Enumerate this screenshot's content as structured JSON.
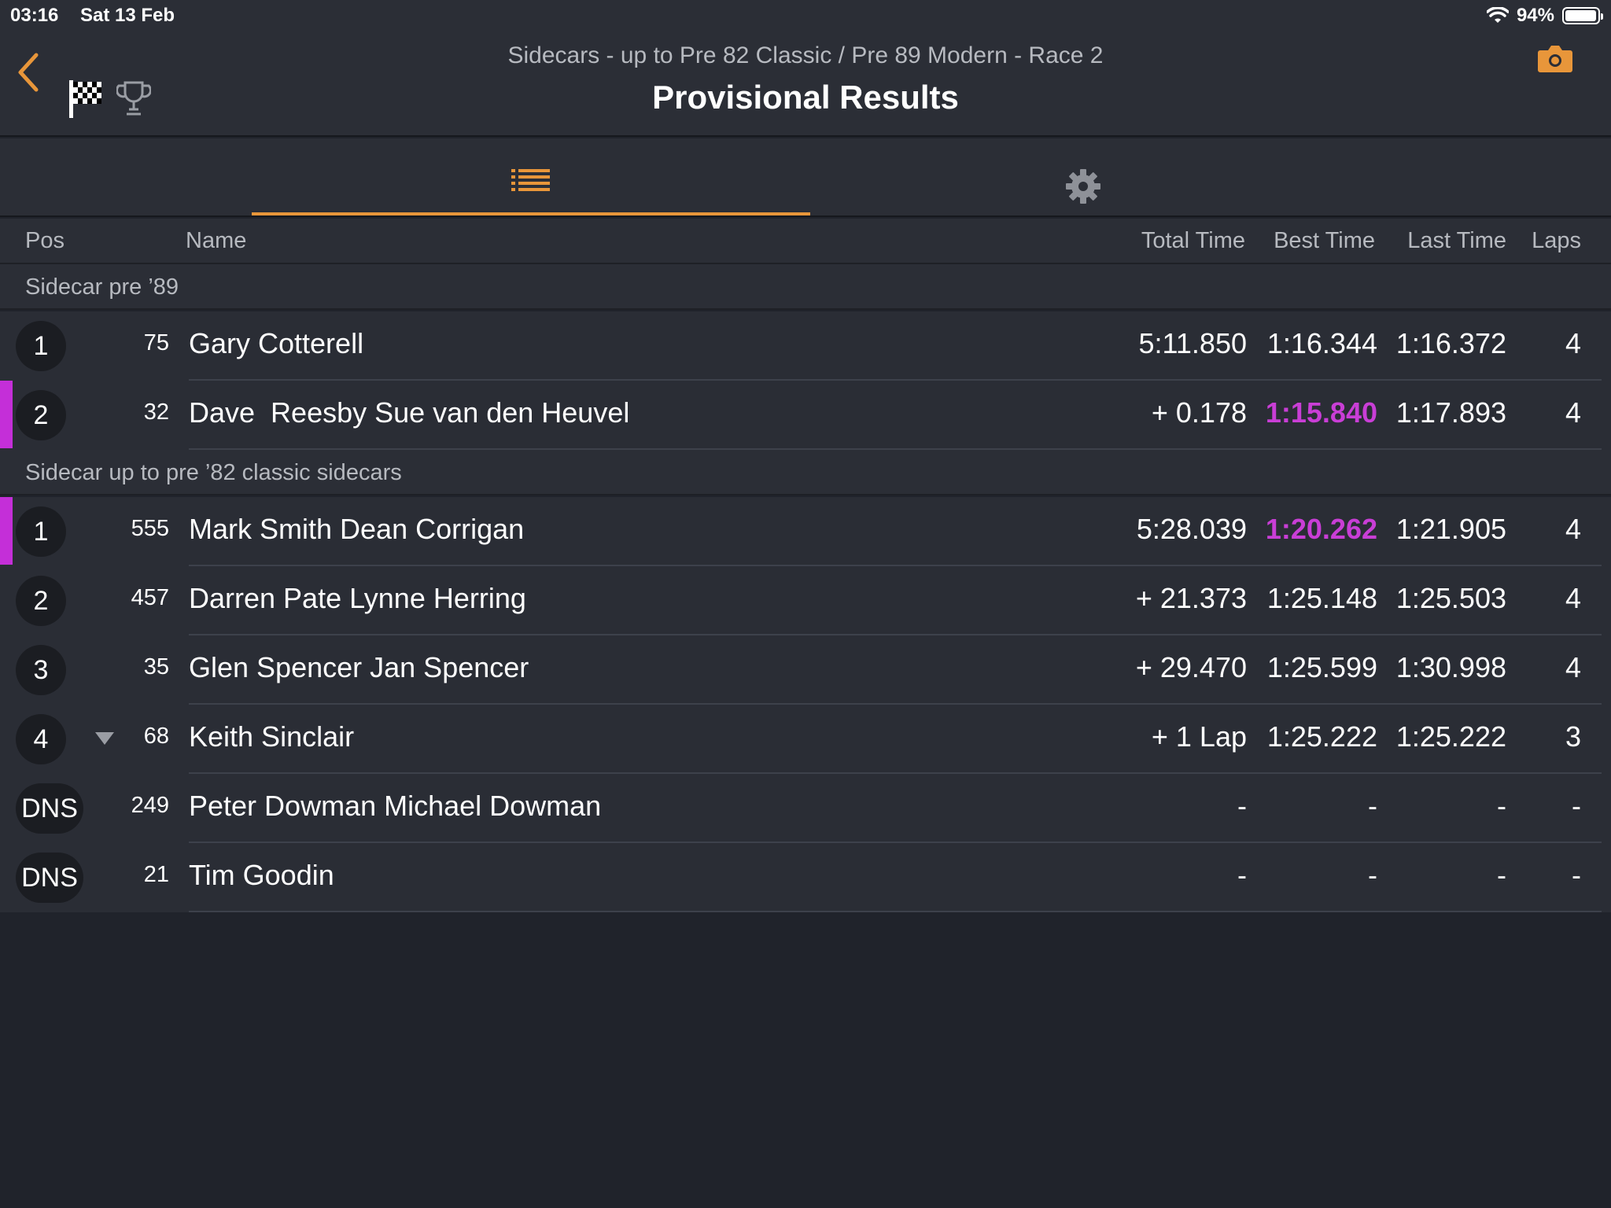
{
  "status": {
    "time": "03:16",
    "date": "Sat 13 Feb",
    "battery": "94%",
    "wifi_icon": "wifi-icon",
    "battery_icon": "battery-icon"
  },
  "header": {
    "subtitle": "Sidecars - up to Pre 82 Classic / Pre 89 Modern - Race 2",
    "title": "Provisional Results",
    "accent_color": "#e8963a"
  },
  "tabs": [
    {
      "name": "results-list",
      "icon": "list-icon",
      "active": true
    },
    {
      "name": "settings",
      "icon": "gear-icon",
      "active": false
    }
  ],
  "columns": {
    "pos": "Pos",
    "name": "Name",
    "total": "Total Time",
    "best": "Best Time",
    "last": "Last Time",
    "laps": "Laps"
  },
  "groups": [
    {
      "label": "Sidecar pre ’89",
      "rows": [
        {
          "pos": "1",
          "num": "75",
          "name": "Gary Cotterell",
          "total": "5:11.850",
          "best": "1:16.344",
          "last": "1:16.372",
          "laps": "4",
          "best_highlight": false,
          "marker": false
        },
        {
          "pos": "2",
          "num": "32",
          "name": "Dave  Reesby Sue van den Heuvel",
          "total": "+ 0.178",
          "best": "1:15.840",
          "last": "1:17.893",
          "laps": "4",
          "best_highlight": true,
          "marker": true
        }
      ]
    },
    {
      "label": "Sidecar up to pre ’82 classic sidecars",
      "rows": [
        {
          "pos": "1",
          "num": "555",
          "name": "Mark Smith Dean Corrigan",
          "total": "5:28.039",
          "best": "1:20.262",
          "last": "1:21.905",
          "laps": "4",
          "best_highlight": true,
          "marker": true
        },
        {
          "pos": "2",
          "num": "457",
          "name": "Darren Pate Lynne Herring",
          "total": "+ 21.373",
          "best": "1:25.148",
          "last": "1:25.503",
          "laps": "4",
          "best_highlight": false,
          "marker": false
        },
        {
          "pos": "3",
          "num": "35",
          "name": "Glen Spencer Jan Spencer",
          "total": "+ 29.470",
          "best": "1:25.599",
          "last": "1:30.998",
          "laps": "4",
          "best_highlight": false,
          "marker": false
        },
        {
          "pos": "4",
          "num": "68",
          "name": "Keith Sinclair",
          "total": "+ 1 Lap",
          "best": "1:25.222",
          "last": "1:25.222",
          "laps": "3",
          "best_highlight": false,
          "marker": false,
          "trend": "down"
        },
        {
          "pos": "DNS",
          "num": "249",
          "name": "Peter Dowman Michael Dowman",
          "total": "-",
          "best": "-",
          "last": "-",
          "laps": "-",
          "best_highlight": false,
          "marker": false
        },
        {
          "pos": "DNS",
          "num": "21",
          "name": "Tim Goodin",
          "total": "-",
          "best": "-",
          "last": "-",
          "laps": "-",
          "best_highlight": false,
          "marker": false
        }
      ]
    }
  ],
  "colors": {
    "best_lap": "#c93ed6",
    "background": "#20232b",
    "panel": "#2b2e36"
  }
}
